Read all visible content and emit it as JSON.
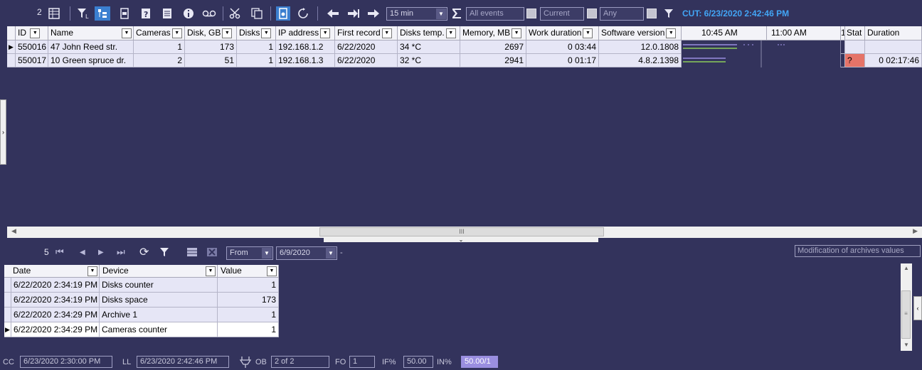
{
  "toolbar": {
    "count": "2",
    "interval": "15 min",
    "events_filter": "All events",
    "current_label": "Current",
    "any_label": "Any",
    "cut_text": "CUT: 6/23/2020 2:42:46 PM",
    "icons": [
      "table-icon",
      "filter-clear-icon",
      "tree-icon",
      "print-icon",
      "help-icon",
      "list-icon",
      "info-icon",
      "tape-icon",
      "scissors-icon",
      "copy-icon",
      "file-icon",
      "refresh-icon",
      "arrow-left-icon",
      "arrow-end-icon",
      "arrow-right-icon",
      "sum-icon",
      "funnel-icon"
    ]
  },
  "grid": {
    "headers": {
      "id": "ID",
      "name": "Name",
      "cameras": "Cameras",
      "disk_gb": "Disk, GB",
      "disks": "Disks",
      "ip": "IP address",
      "first_record": "First record",
      "disks_temp": "Disks temp.",
      "memory": "Memory, MB",
      "work_duration": "Work duration",
      "software_version": "Software version",
      "time1": "10:45 AM",
      "time2": "11:00 AM",
      "marker": "1",
      "stat": "Stat",
      "duration": "Duration"
    },
    "rows": [
      {
        "id": "550016",
        "name": "47 John Reed str.",
        "cameras": "1",
        "disk_gb": "173",
        "disks": "1",
        "ip": "192.168.1.2",
        "first_record": "6/22/2020",
        "disks_temp": "34 *C",
        "memory": "2697",
        "work_duration": "0 03:44",
        "software_version": "12.0.1808",
        "stat": "",
        "duration": ""
      },
      {
        "id": "550017",
        "name": "10 Green spruce dr.",
        "cameras": "2",
        "disk_gb": "51",
        "disks": "1",
        "ip": "192.168.1.3",
        "first_record": "6/22/2020",
        "disks_temp": "32 *C",
        "memory": "2941",
        "work_duration": "0 01:17",
        "software_version": "4.8.2.1398",
        "stat": "?",
        "duration": "0 02:17:46"
      }
    ],
    "scroll_thumb": "III"
  },
  "lower": {
    "count": "5",
    "from_label": "From",
    "date": "6/9/2020",
    "dash": "-",
    "tooltip": "Modification of archives values",
    "headers": {
      "date": "Date",
      "device": "Device",
      "value": "Value"
    },
    "rows": [
      {
        "date": "6/22/2020 2:34:19 PM",
        "device": "Disks counter",
        "value": "1"
      },
      {
        "date": "6/22/2020 2:34:19 PM",
        "device": "Disks space",
        "value": "173"
      },
      {
        "date": "6/22/2020 2:34:29 PM",
        "device": "Archive 1",
        "value": "1"
      },
      {
        "date": "6/22/2020 2:34:29 PM",
        "device": "Cameras counter",
        "value": "1"
      }
    ]
  },
  "status": {
    "cc_label": "CC",
    "cc_value": "6/23/2020 2:30:00 PM",
    "ll_label": "LL",
    "ll_value": "6/23/2020 2:42:46 PM",
    "ob_label": "OB",
    "ob_value": "2 of 2",
    "fo_label": "FO",
    "fo_value": "1",
    "if_label": "IF%",
    "if_value": "50.00",
    "in_label": "IN%",
    "in_value": "50.00/1"
  },
  "colors": {
    "background": "#33335c",
    "row": "#e6e6f6",
    "accent_blue": "#42a5f5",
    "stat_red": "#e57368",
    "highlight": "#9a8ee0"
  }
}
